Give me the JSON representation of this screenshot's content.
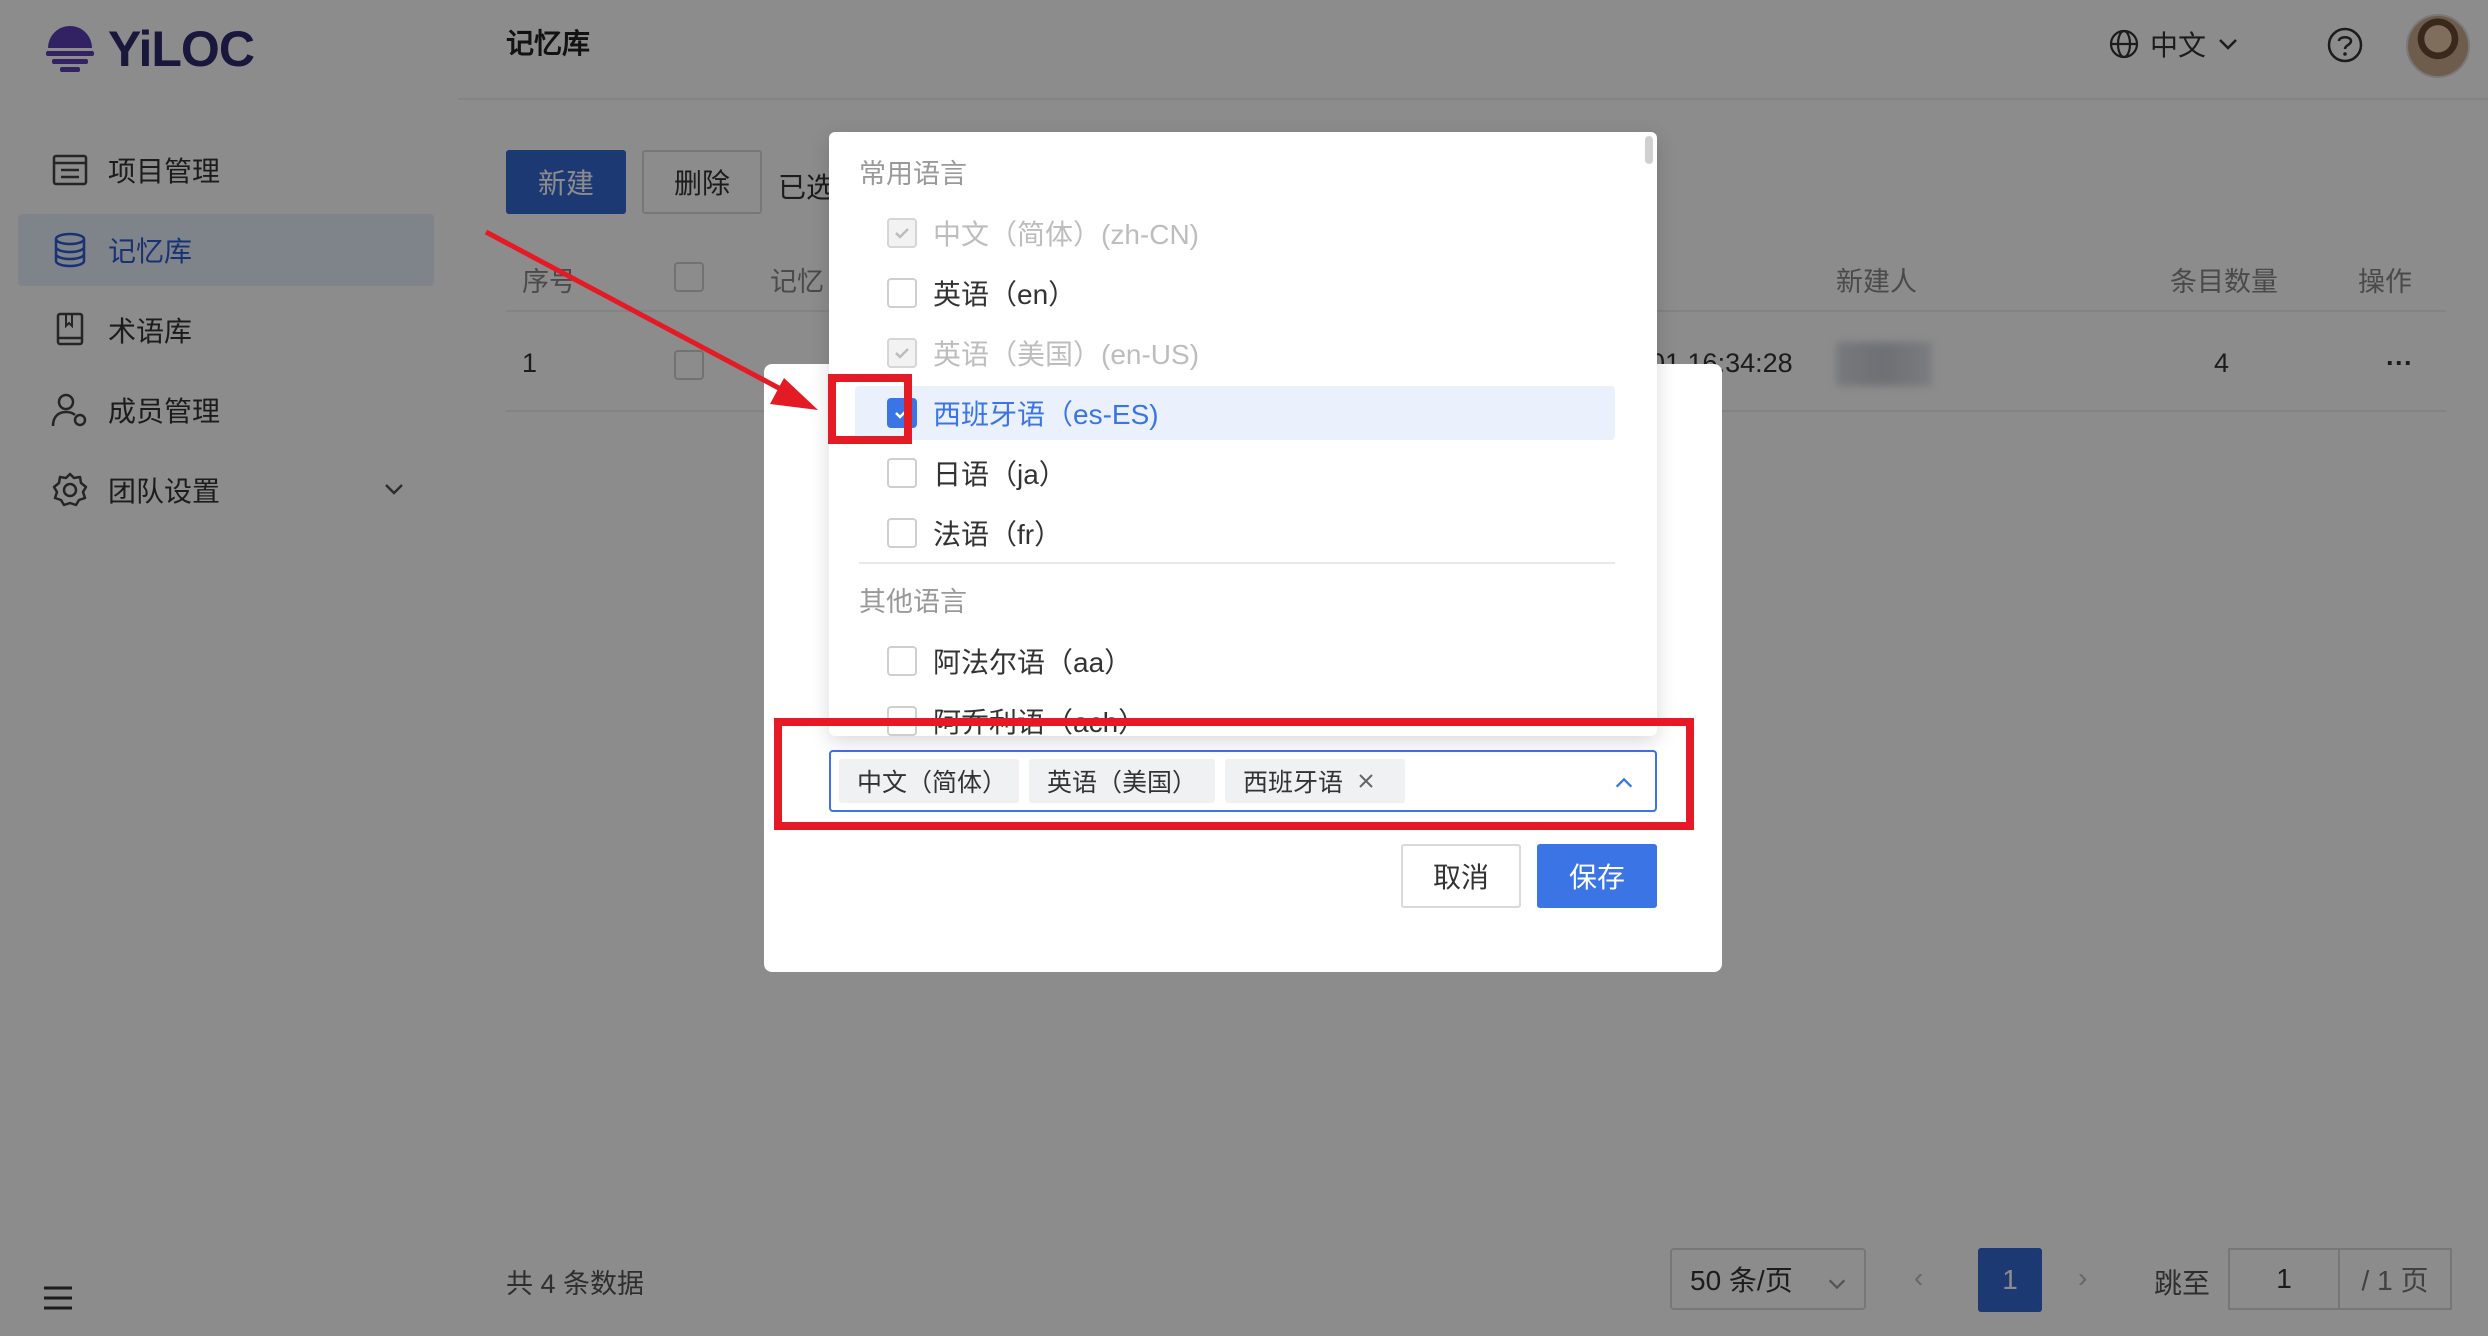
{
  "app": {
    "logo_text": "YiLOC"
  },
  "sidebar": {
    "items": [
      {
        "label": "项目管理",
        "icon": "project-list-icon"
      },
      {
        "label": "记忆库",
        "icon": "database-icon"
      },
      {
        "label": "术语库",
        "icon": "book-icon"
      },
      {
        "label": "成员管理",
        "icon": "user-settings-icon"
      },
      {
        "label": "团队设置",
        "icon": "gear-icon"
      }
    ]
  },
  "header": {
    "title": "记忆库",
    "language": "中文"
  },
  "toolbar": {
    "new_label": "新建",
    "delete_label": "删除",
    "selected_label": "已选"
  },
  "table": {
    "columns": [
      "序号",
      "记忆",
      "新建人",
      "条目数量",
      "操作"
    ],
    "rows": [
      {
        "index": "1",
        "created_time": "01 16:34:28",
        "count": "4",
        "actions": "···"
      }
    ]
  },
  "footer": {
    "total": "共 4 条数据",
    "page_size": "50 条/页",
    "current_page": "1",
    "jump_label": "跳至",
    "jump_value": "1",
    "total_pages": "/ 1 页"
  },
  "modal": {
    "cancel_label": "取消",
    "save_label": "保存",
    "selected_tags": [
      "中文（简体）",
      "英语（美国）",
      "西班牙语"
    ],
    "dropdown": {
      "common_label": "常用语言",
      "other_label": "其他语言",
      "common_options": [
        {
          "label": "中文（简体）(zh-CN)",
          "state": "disabled-checked"
        },
        {
          "label": "英语（en）",
          "state": "unchecked"
        },
        {
          "label": "英语（美国）(en-US)",
          "state": "disabled-checked"
        },
        {
          "label": "西班牙语（es-ES)",
          "state": "checked"
        },
        {
          "label": "日语（ja）",
          "state": "unchecked"
        },
        {
          "label": "法语（fr）",
          "state": "unchecked"
        }
      ],
      "other_options": [
        {
          "label": "阿法尔语（aa）",
          "state": "unchecked"
        },
        {
          "label": "阿乔利语（ach）",
          "state": "unchecked"
        }
      ]
    }
  },
  "colors": {
    "primary": "#3469d4",
    "annotation_red": "#e41a25",
    "active_bg": "#e8eefb"
  }
}
